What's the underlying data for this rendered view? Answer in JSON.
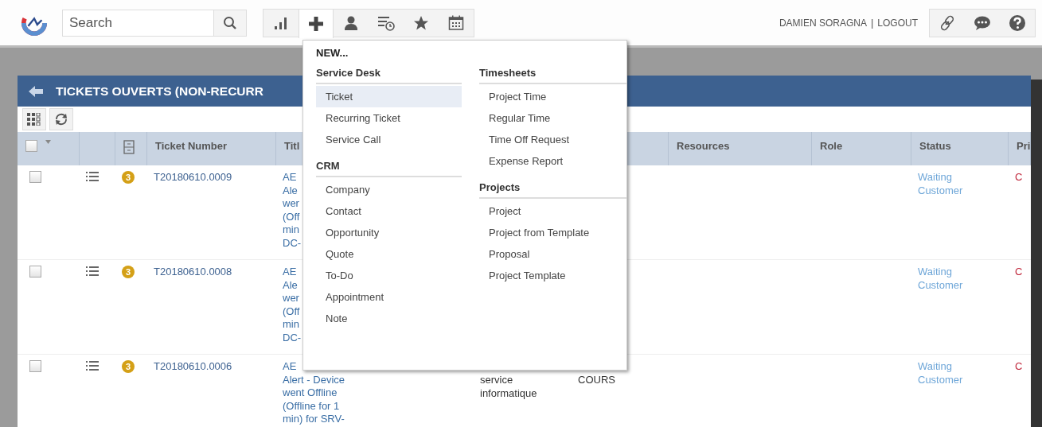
{
  "search": {
    "placeholder": "Search"
  },
  "user": {
    "name": "DAMIEN SORAGNA",
    "separator": "|",
    "logout": "LOGOUT"
  },
  "panel": {
    "title": "TICKETS OUVERTS (NON-RECURR"
  },
  "table": {
    "select_all_checked": false,
    "columns": [
      "Ticket Number",
      "Titl",
      "Resources",
      "Role",
      "Status",
      "Pri"
    ],
    "rows": [
      {
        "checked": false,
        "badge": "3",
        "ticket_number": "T20180610.0009",
        "title_lines": [
          "AE",
          "Ale",
          "wer",
          "(Off",
          "min",
          "DC-"
        ],
        "status": "Waiting Customer",
        "priority": "C"
      },
      {
        "checked": false,
        "badge": "3",
        "ticket_number": "T20180610.0008",
        "title_lines": [
          "AE",
          "Ale",
          "wer",
          "(Off",
          "min",
          "DC-"
        ],
        "status": "Waiting Customer",
        "priority": "C"
      },
      {
        "checked": false,
        "badge": "3",
        "ticket_number": "T20180610.0006",
        "title_lines": [
          "AE",
          "Alert - Device",
          "went Offline",
          "(Offline for 1",
          "min) for SRV-"
        ],
        "column_6": "service informatique",
        "column_7": "COURS",
        "status": "Waiting Customer",
        "priority": "C"
      }
    ]
  },
  "new_menu": {
    "heading": "NEW...",
    "columns": [
      {
        "sections": [
          {
            "title": "Service Desk",
            "items": [
              {
                "label": "Ticket",
                "selected": true
              },
              {
                "label": "Recurring Ticket",
                "selected": false
              },
              {
                "label": "Service Call",
                "selected": false
              }
            ]
          },
          {
            "title": "CRM",
            "items": [
              {
                "label": "Company",
                "selected": false
              },
              {
                "label": "Contact",
                "selected": false
              },
              {
                "label": "Opportunity",
                "selected": false
              },
              {
                "label": "Quote",
                "selected": false
              },
              {
                "label": "To-Do",
                "selected": false
              },
              {
                "label": "Appointment",
                "selected": false
              },
              {
                "label": "Note",
                "selected": false
              }
            ]
          }
        ]
      },
      {
        "sections": [
          {
            "title": "Timesheets",
            "items": [
              {
                "label": "Project Time",
                "selected": false
              },
              {
                "label": "Regular Time",
                "selected": false
              },
              {
                "label": "Time Off Request",
                "selected": false
              },
              {
                "label": "Expense Report",
                "selected": false
              }
            ]
          },
          {
            "title": "Projects",
            "items": [
              {
                "label": "Project",
                "selected": false
              },
              {
                "label": "Project from Template",
                "selected": false
              },
              {
                "label": "Proposal",
                "selected": false
              },
              {
                "label": "Project Template",
                "selected": false
              }
            ]
          }
        ]
      }
    ]
  }
}
